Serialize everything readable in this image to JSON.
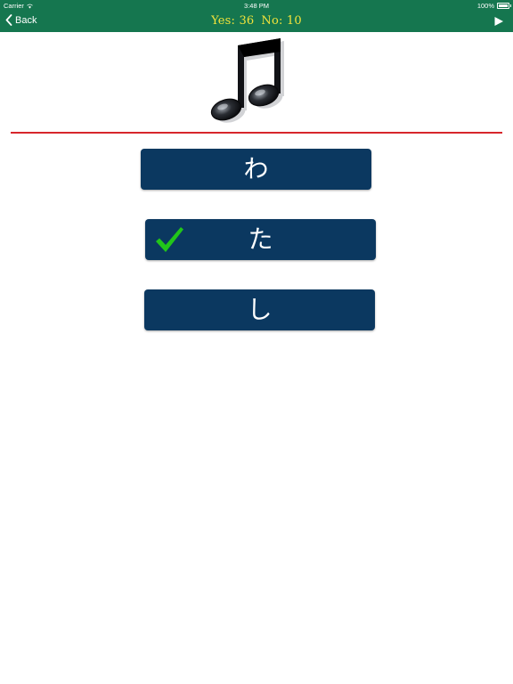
{
  "status_bar": {
    "carrier": "Carrier",
    "time": "3:48 PM",
    "battery": "100%"
  },
  "nav": {
    "back_label": "Back",
    "score": {
      "yes_label": "Yes: 36",
      "no_label": "No: 10"
    },
    "play_icon": "play-icon"
  },
  "question": {
    "icon": "music-note-icon"
  },
  "choices": [
    {
      "label": "わ",
      "checked": false
    },
    {
      "label": "た",
      "checked": true
    },
    {
      "label": "し",
      "checked": false
    }
  ],
  "colors": {
    "bar": "#15764f",
    "score": "#f2e33a",
    "divider": "#d7262b",
    "choice_bg": "#0b3860",
    "check": "#22c51a"
  }
}
